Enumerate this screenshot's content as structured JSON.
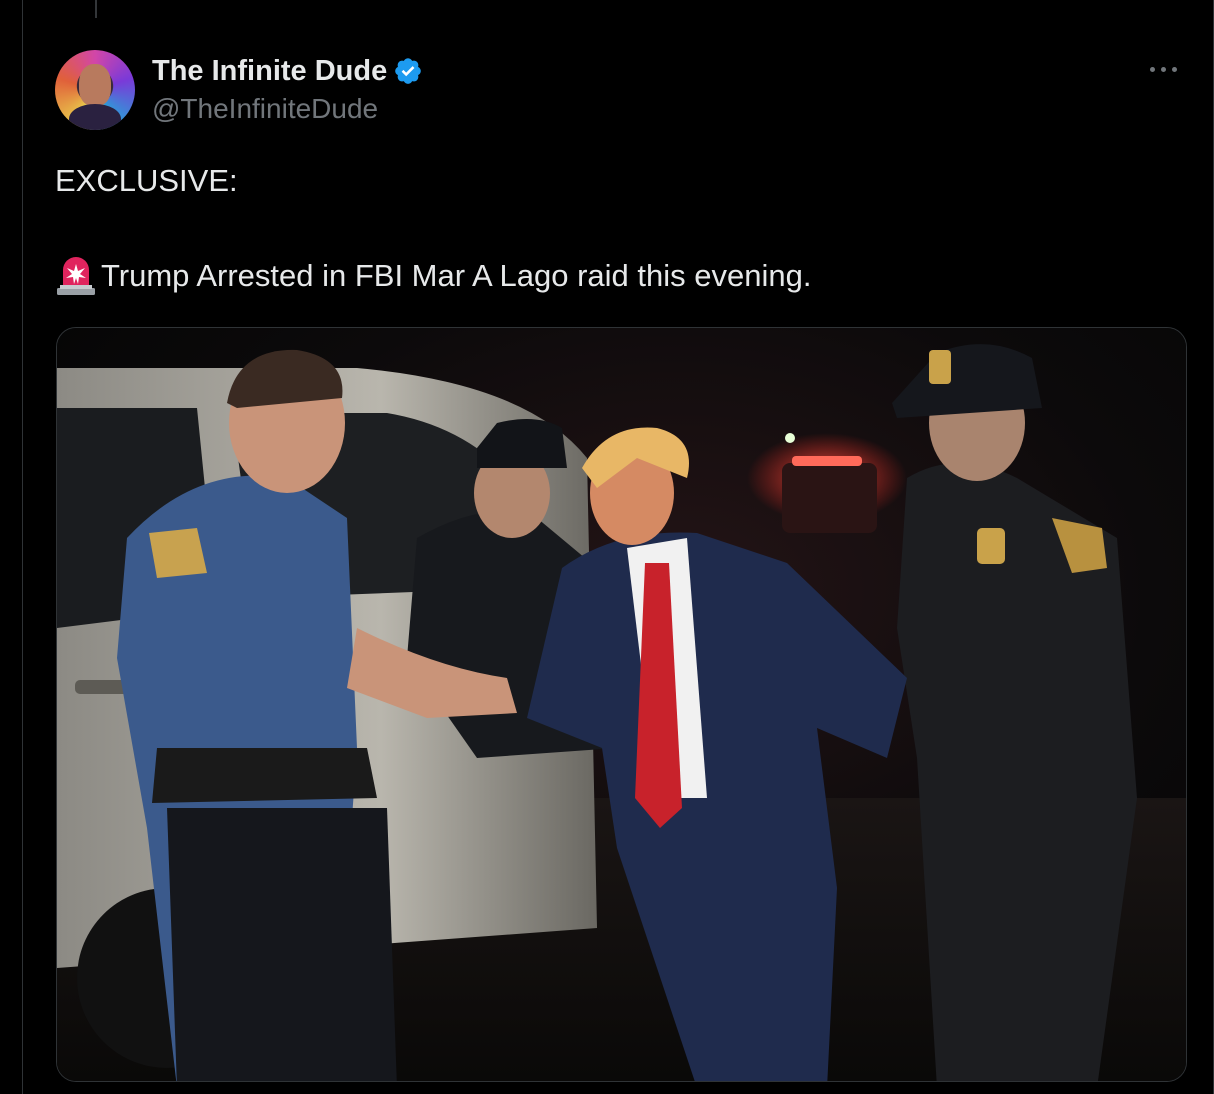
{
  "tweet": {
    "display_name": "The Infinite Dude",
    "handle": "@TheInfiniteDude",
    "verified": true,
    "text_line1": "EXCLUSIVE:",
    "text_line2": "Trump Arrested in FBI Mar A Lago raid this evening.",
    "emoji": "rotating-light-icon"
  },
  "colors": {
    "background": "#000000",
    "text": "#e7e9ea",
    "secondary": "#71767b",
    "verified": "#1d9bf0"
  }
}
